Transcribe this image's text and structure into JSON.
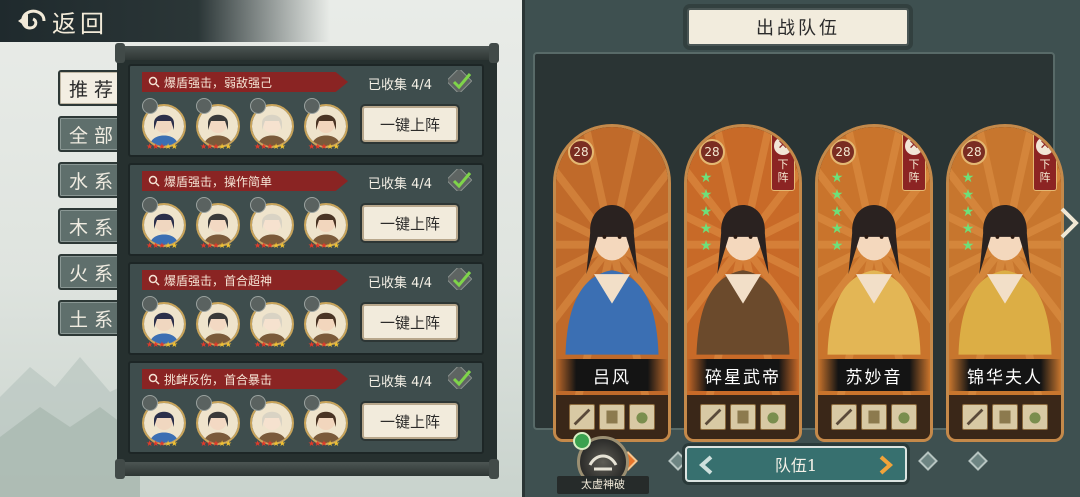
{
  "back": {
    "label": "返回"
  },
  "tabs": [
    {
      "label": "推荐",
      "active": true
    },
    {
      "label": "全部",
      "active": false
    },
    {
      "label": "水系",
      "active": false
    },
    {
      "label": "木系",
      "active": false
    },
    {
      "label": "火系",
      "active": false
    },
    {
      "label": "土系",
      "active": false
    }
  ],
  "lineups": [
    {
      "tag": "爆盾强击，弱敌强己",
      "collected": "已收集 4/4",
      "button": "一键上阵"
    },
    {
      "tag": "爆盾强击，操作简单",
      "collected": "已收集 4/4",
      "button": "一键上阵"
    },
    {
      "tag": "爆盾强击，首合超神",
      "collected": "已收集 4/4",
      "button": "一键上阵"
    },
    {
      "tag": "挑衅反伤，首合暴击",
      "collected": "已收集 4/4",
      "button": "一键上阵"
    }
  ],
  "team": {
    "title": "出战队伍",
    "heroes": [
      {
        "name": "吕风",
        "level": "28",
        "stars": 0,
        "removable": false,
        "bg": "#c06a2a",
        "robe": "#3b6fb3"
      },
      {
        "name": "碎星武帝",
        "level": "28",
        "stars": 5,
        "removable": true,
        "bg": "#c86a28",
        "robe": "#6b4a2c"
      },
      {
        "name": "苏妙音",
        "level": "28",
        "stars": 5,
        "removable": true,
        "bg": "#c9742c",
        "robe": "#e3b655"
      },
      {
        "name": "锦华夫人",
        "level": "28",
        "stars": 5,
        "removable": true,
        "bg": "#c7762e",
        "robe": "#dcae45"
      }
    ],
    "remove_label": "下阵",
    "page_count": 8,
    "active_page": 1,
    "skill_label": "太虚神破",
    "selector_label": "队伍1"
  },
  "colors": {
    "accent_red": "#8c2423",
    "star_green": "#6ee07a",
    "selector_teal": "#37706f"
  }
}
